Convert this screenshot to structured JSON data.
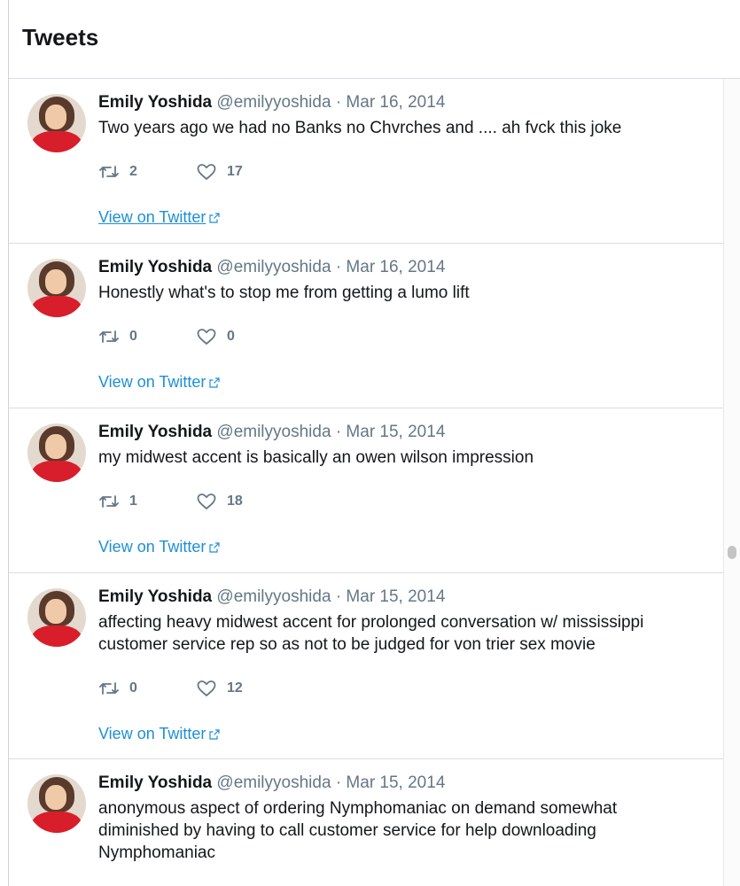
{
  "header": {
    "title": "Tweets"
  },
  "tweets": [
    {
      "name": "Emily Yoshida",
      "handle": "@emilyyoshida",
      "separator": "·",
      "date": "Mar 16, 2014",
      "text": "Two years ago we had no Banks no Chvrches and .... ah fvck this joke",
      "retweets": "2",
      "likes": "17",
      "link": "View on Twitter"
    },
    {
      "name": "Emily Yoshida",
      "handle": "@emilyyoshida",
      "separator": "·",
      "date": "Mar 16, 2014",
      "text": "Honestly what's to stop me from getting a lumo lift",
      "retweets": "0",
      "likes": "0",
      "link": "View on Twitter"
    },
    {
      "name": "Emily Yoshida",
      "handle": "@emilyyoshida",
      "separator": "·",
      "date": "Mar 15, 2014",
      "text": "my midwest accent is basically an owen wilson impression",
      "retweets": "1",
      "likes": "18",
      "link": "View on Twitter"
    },
    {
      "name": "Emily Yoshida",
      "handle": "@emilyyoshida",
      "separator": "·",
      "date": "Mar 15, 2014",
      "text": "affecting heavy midwest accent for prolonged conversation w/ mississippi customer service rep so as not to be judged for von trier sex movie",
      "retweets": "0",
      "likes": "12",
      "link": "View on Twitter"
    },
    {
      "name": "Emily Yoshida",
      "handle": "@emilyyoshida",
      "separator": "·",
      "date": "Mar 15, 2014",
      "text": "anonymous aspect of ordering Nymphomaniac on demand somewhat diminished by having to call customer service for help downloading Nymphomaniac",
      "retweets": "",
      "likes": "",
      "link": ""
    }
  ],
  "colors": {
    "link": "#1d8fd6",
    "muted": "#657786",
    "text": "#14171a",
    "divider": "#d9dde1"
  },
  "icons": {
    "retweet": "retweet-icon",
    "like": "heart-icon",
    "external": "external-link-icon"
  }
}
